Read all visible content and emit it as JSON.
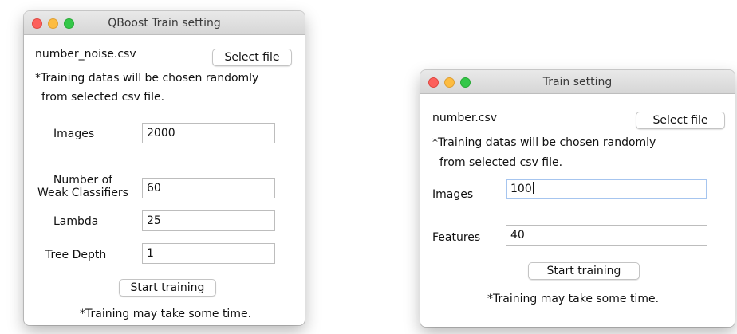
{
  "left_window": {
    "title": "QBoost Train setting",
    "file_name": "number_noise.csv",
    "select_file_label": "Select file",
    "note_line1": "*Training datas will be chosen randomly",
    "note_line2": "from selected csv file.",
    "images_label": "Images",
    "images_value": "2000",
    "weak_label_line1": "Number of",
    "weak_label_line2": "Weak Classifiers",
    "weak_value": "60",
    "lambda_label": "Lambda",
    "lambda_value": "25",
    "tree_depth_label": "Tree Depth",
    "tree_depth_value": "1",
    "start_label": "Start training",
    "footer_note": "*Training may take some time."
  },
  "right_window": {
    "title": "Train setting",
    "file_name": "number.csv",
    "select_file_label": "Select file",
    "note_line1": "*Training datas will be chosen randomly",
    "note_line2": "from selected csv file.",
    "images_label": "Images",
    "images_value": "100",
    "features_label": "Features",
    "features_value": "40",
    "start_label": "Start training",
    "footer_note": "*Training may take some time."
  },
  "colors": {
    "close": "#fc605c",
    "minimize": "#fdbc40",
    "maximize": "#34c749",
    "focus_ring": "#a6c5ef"
  }
}
